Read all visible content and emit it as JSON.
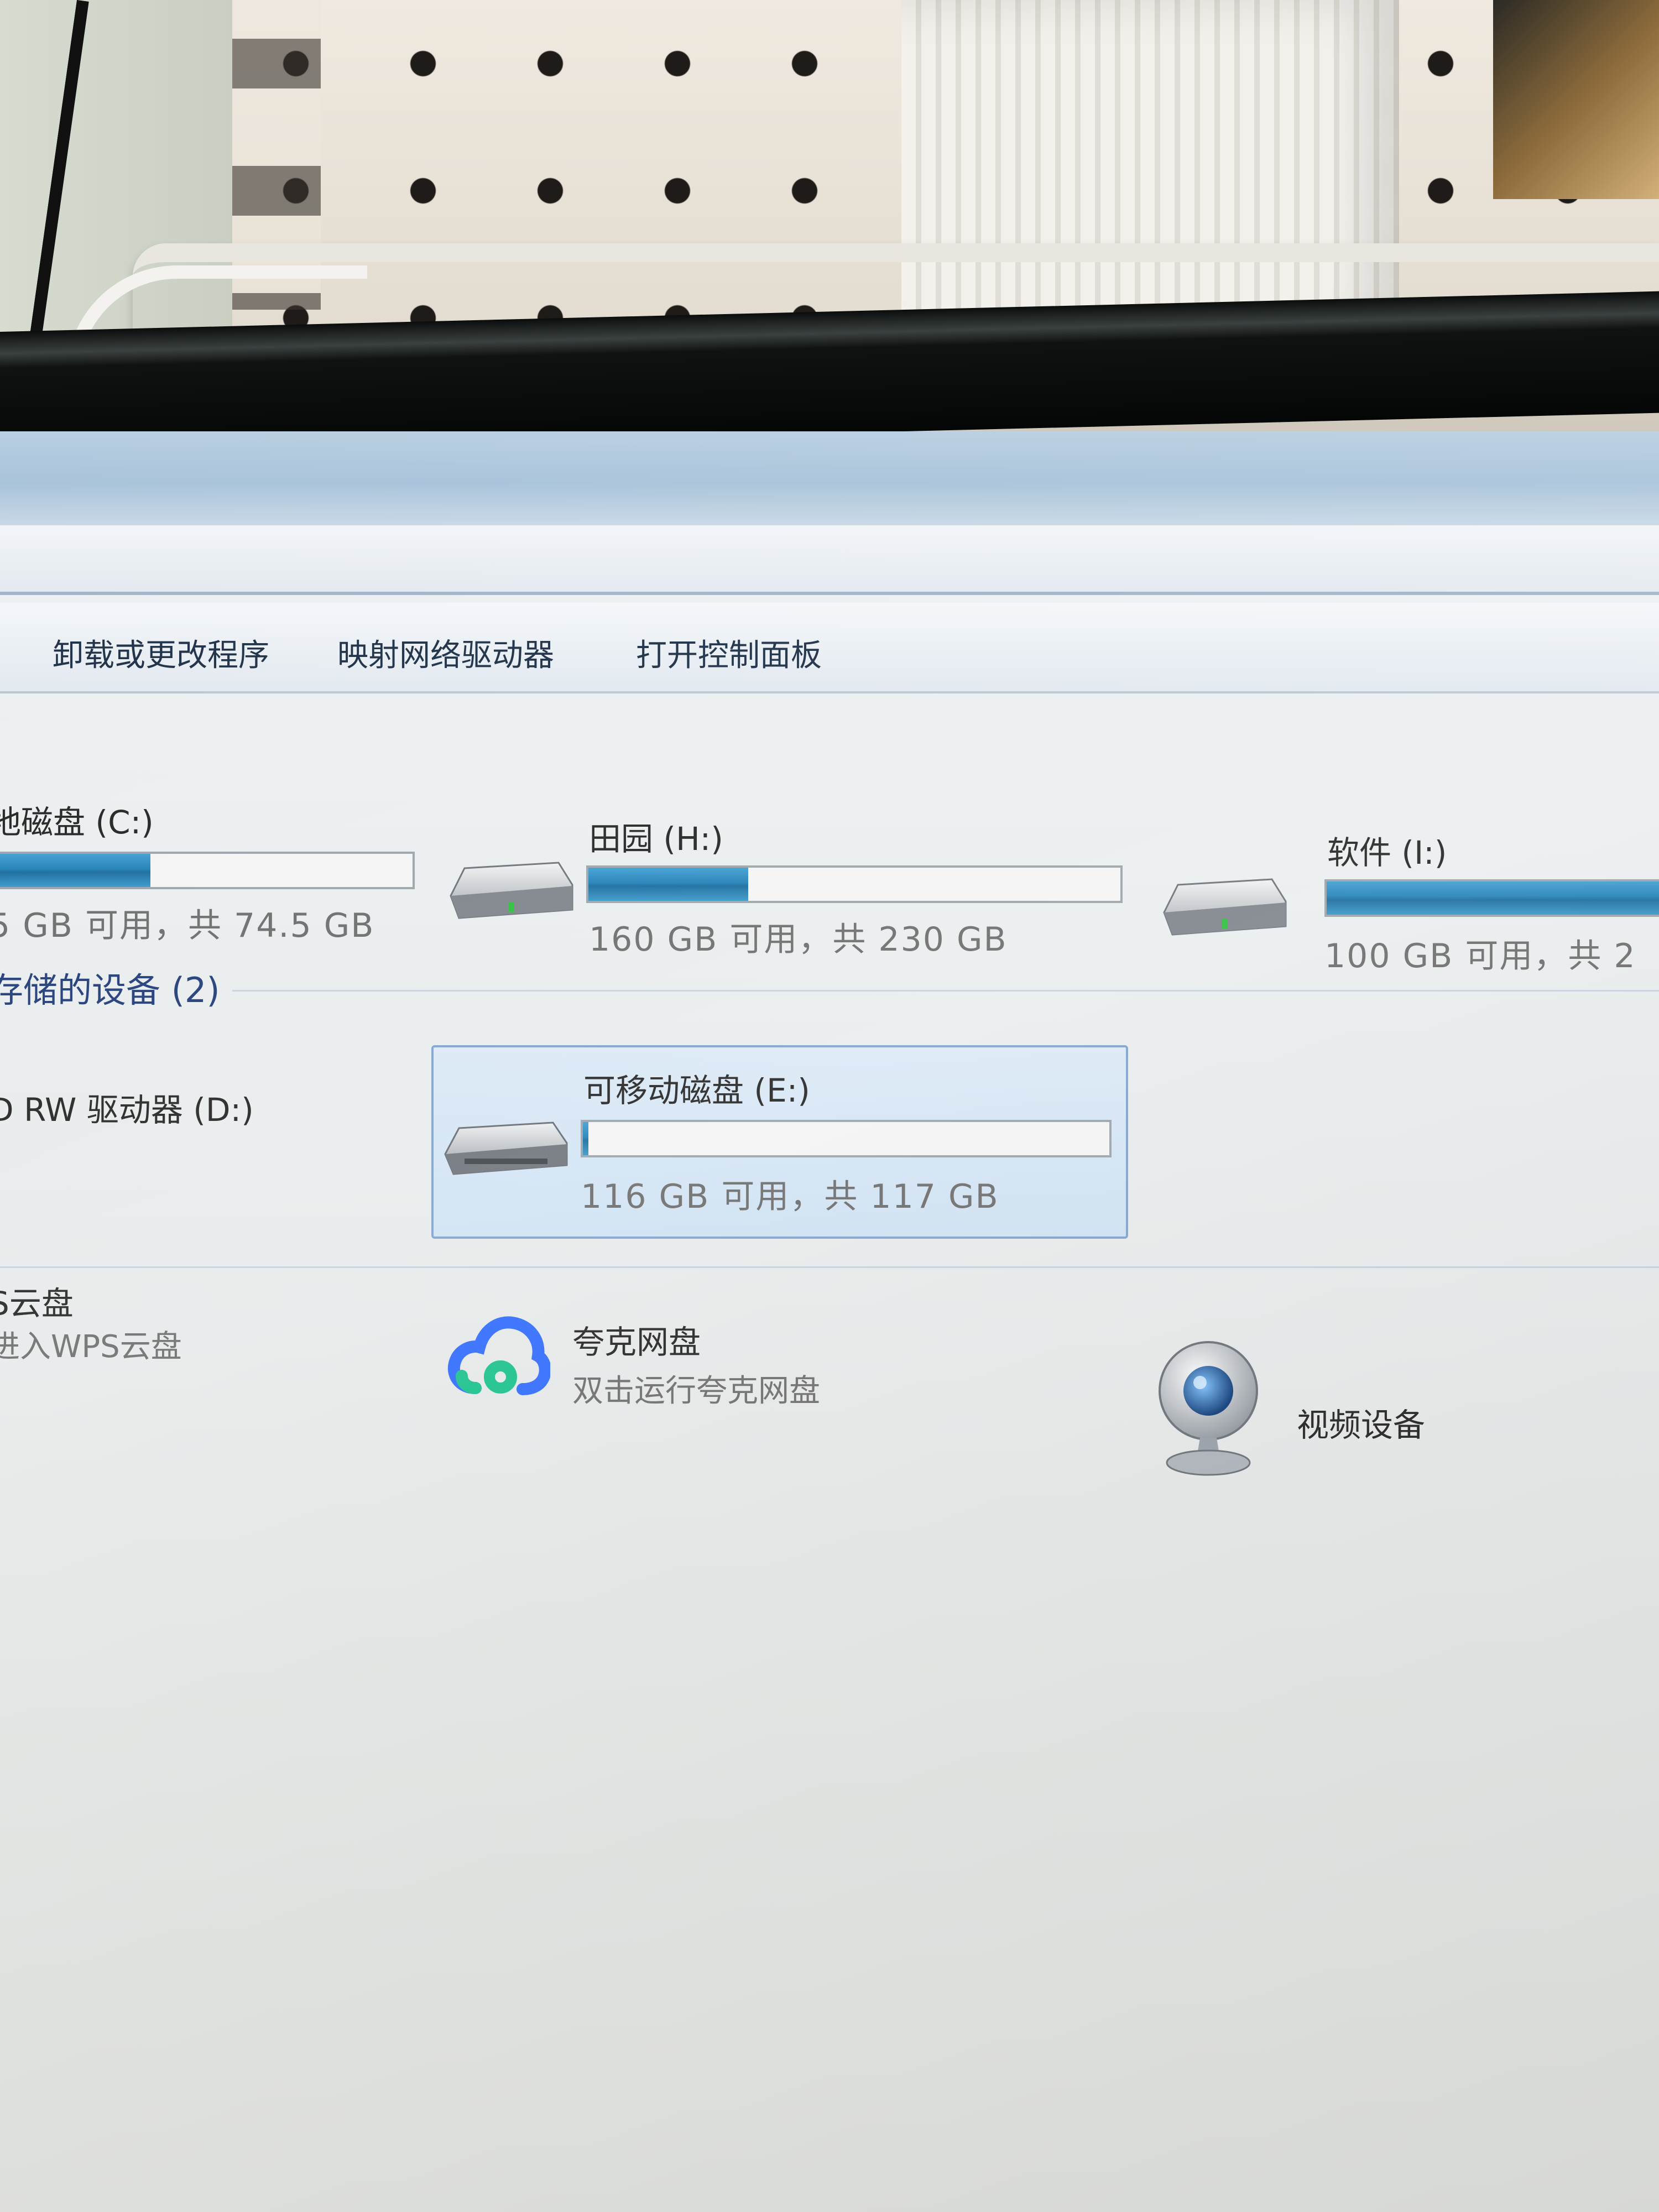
{
  "toolbar": {
    "uninstall_label": "卸载或更改程序",
    "map_drive_label": "映射网络驱动器",
    "control_panel_label": "打开控制面板"
  },
  "hard_drives": [
    {
      "name": "地磁盘 (C:)",
      "free_text": "5 GB 可用，共 74.5 GB",
      "used_fraction": 0.37,
      "icon": "hard-drive-icon"
    },
    {
      "name": "田园 (H:)",
      "free_text": "160 GB 可用，共 230 GB",
      "used_fraction": 0.3,
      "icon": "hard-drive-icon"
    },
    {
      "name": "软件 (I:)",
      "free_text": "100 GB 可用，共 2",
      "used_fraction": 1.0,
      "icon": "hard-drive-icon"
    }
  ],
  "removable_section": {
    "title": "存储的设备 (2)",
    "dvd": {
      "name": "D RW 驱动器 (D:)"
    },
    "removable": {
      "name": "可移动磁盘 (E:)",
      "free_text": "116 GB 可用，共 117 GB",
      "used_fraction": 0.01,
      "icon": "removable-disk-icon"
    }
  },
  "other_items": {
    "wps": {
      "name": "S云盘",
      "sub": "进入WPS云盘"
    },
    "quark": {
      "name": "夸克网盘",
      "sub": "双击运行夸克网盘",
      "icon": "cloud-icon"
    },
    "video": {
      "name": "视频设备",
      "icon": "webcam-icon"
    }
  },
  "colors": {
    "bar_fill": "#1f7fb8",
    "section_title": "#1e3a78",
    "selection": "#cfe2f3",
    "quark_blue": "#2f6bff",
    "quark_green": "#18c28a"
  }
}
